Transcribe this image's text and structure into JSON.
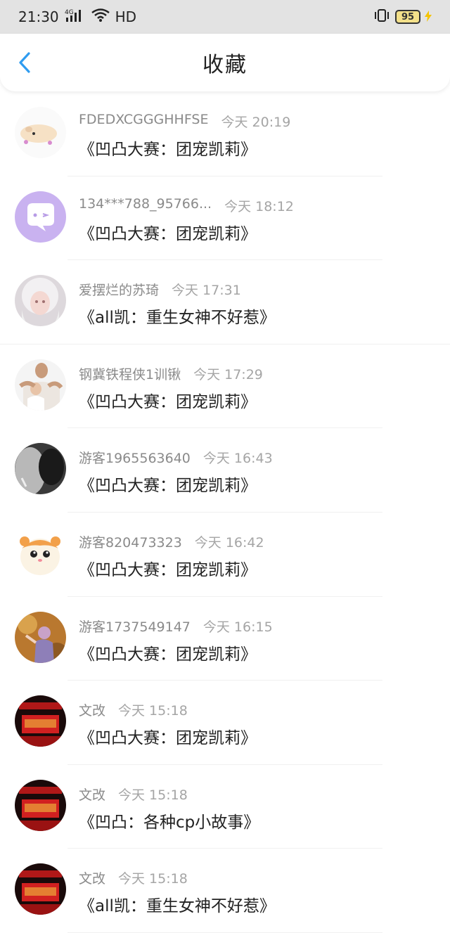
{
  "status_bar": {
    "time": "21:30",
    "network": "4G",
    "hd": "HD",
    "battery": "95"
  },
  "header": {
    "title": "收藏"
  },
  "items": [
    {
      "user": "FDEDXCGGGHHFSE",
      "time": "今天 20:19",
      "book": "《凹凸大赛：团宠凯莉》",
      "avatar": "hamster-toy-avatar"
    },
    {
      "user": "134***788_95766...",
      "time": "今天 18:12",
      "book": "《凹凸大赛：团宠凯莉》",
      "avatar": "purple-chat-avatar"
    },
    {
      "user": "爱摆烂的苏琦",
      "time": "今天 17:31",
      "book": "《all凯：重生女神不好惹》",
      "avatar": "white-hair-girl-avatar"
    },
    {
      "user": "钢冀铁程侠1训锹",
      "time": "今天 17:29",
      "book": "《凹凸大赛：团宠凯莉》",
      "avatar": "man-with-child-avatar"
    },
    {
      "user": "游客1965563640",
      "time": "今天 16:43",
      "book": "《凹凸大赛：团宠凯莉》",
      "avatar": "monochrome-face-avatar"
    },
    {
      "user": "游客820473323",
      "time": "今天 16:42",
      "book": "《凹凸大赛：团宠凯莉》",
      "avatar": "cartoon-hamster-avatar"
    },
    {
      "user": "游客1737549147",
      "time": "今天 16:15",
      "book": "《凹凸大赛：团宠凯莉》",
      "avatar": "autumn-girl-avatar"
    },
    {
      "user": "文改",
      "time": "今天 15:18",
      "book": "《凹凸大赛：团宠凯莉》",
      "avatar": "red-stage-avatar"
    },
    {
      "user": "文改",
      "time": "今天 15:18",
      "book": "《凹凸：各种cp小故事》",
      "avatar": "red-stage-avatar"
    },
    {
      "user": "文改",
      "time": "今天 15:18",
      "book": "《all凯：重生女神不好惹》",
      "avatar": "red-stage-avatar"
    }
  ],
  "colors": {
    "accent": "#2f9cf0",
    "status_bg": "#e3e3e3",
    "meta_text": "#8a8a8a",
    "body_text": "#222222"
  }
}
